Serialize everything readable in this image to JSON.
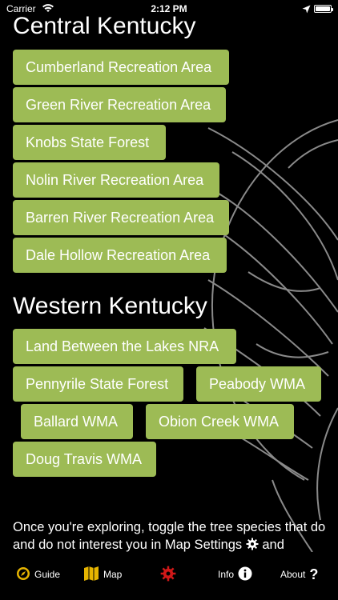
{
  "status": {
    "carrier": "Carrier",
    "time": "2:12 PM"
  },
  "central": {
    "title": "Central Kentucky",
    "areas": [
      "Cumberland Recreation Area",
      "Green River Recreation Area",
      "Knobs State Forest",
      "Nolin River Recreation Area",
      "Barren River Recreation Area",
      "Dale Hollow Recreation Area"
    ]
  },
  "western": {
    "title": "Western Kentucky",
    "areas": [
      "Land Between the Lakes NRA",
      "Pennyrile State Forest",
      "Peabody WMA",
      "Ballard WMA",
      "Obion Creek WMA",
      "Doug Travis WMA"
    ]
  },
  "footer": {
    "text_before": "Once you're exploring, toggle the tree species that do and do not interest you in Map Settings",
    "text_after": "and"
  },
  "tabs": {
    "guide": "Guide",
    "map": "Map",
    "info": "Info",
    "about": "About"
  },
  "colors": {
    "button_bg": "#9dbb55",
    "background": "#000000",
    "settings_icon": "#d01818",
    "icon_gold": "#e6b400"
  },
  "icons": [
    "wifi-icon",
    "location-arrow-icon",
    "battery-icon",
    "compass-icon",
    "map-icon",
    "gear-icon",
    "info-icon",
    "question-icon"
  ]
}
